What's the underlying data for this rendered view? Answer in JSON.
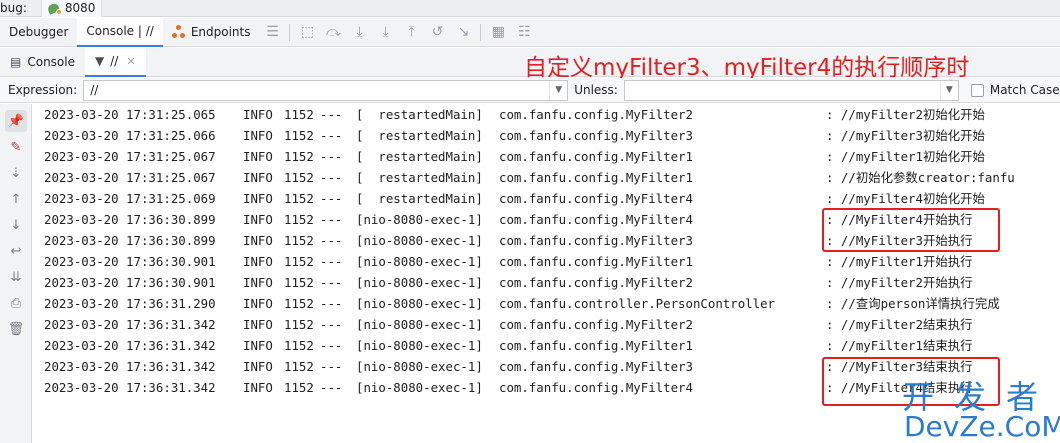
{
  "topbar": {
    "debug_label": "bug:",
    "run_tab_label": "8080"
  },
  "tabs": {
    "debugger": "Debugger",
    "console": "Console | //",
    "endpoints": "Endpoints"
  },
  "subtabs": {
    "console": "Console",
    "filter": "//"
  },
  "annotation": "自定义myFilter3、myFilter4的执行顺序时",
  "filter_bar": {
    "expression_label": "Expression:",
    "expression_value": "//",
    "unless_label": "Unless:",
    "unless_value": "",
    "match_case_label": "Match Case"
  },
  "log_lines": [
    {
      "ts": "2023-03-20 17:31:25.065",
      "level": "INFO",
      "pid": "1152",
      "sep": "---",
      "thread": "[  restartedMain]",
      "logger": "com.fanfu.config.MyFilter2",
      "msg": ": //myFilter2初始化开始"
    },
    {
      "ts": "2023-03-20 17:31:25.066",
      "level": "INFO",
      "pid": "1152",
      "sep": "---",
      "thread": "[  restartedMain]",
      "logger": "com.fanfu.config.MyFilter3",
      "msg": ": //myFilter3初始化开始"
    },
    {
      "ts": "2023-03-20 17:31:25.067",
      "level": "INFO",
      "pid": "1152",
      "sep": "---",
      "thread": "[  restartedMain]",
      "logger": "com.fanfu.config.MyFilter1",
      "msg": ": //myFilter1初始化开始"
    },
    {
      "ts": "2023-03-20 17:31:25.067",
      "level": "INFO",
      "pid": "1152",
      "sep": "---",
      "thread": "[  restartedMain]",
      "logger": "com.fanfu.config.MyFilter1",
      "msg": ": //初始化参数creator:fanfu"
    },
    {
      "ts": "2023-03-20 17:31:25.069",
      "level": "INFO",
      "pid": "1152",
      "sep": "---",
      "thread": "[  restartedMain]",
      "logger": "com.fanfu.config.MyFilter4",
      "msg": ": //myFilter4初始化开始"
    },
    {
      "ts": "2023-03-20 17:36:30.899",
      "level": "INFO",
      "pid": "1152",
      "sep": "---",
      "thread": "[nio-8080-exec-1]",
      "logger": "com.fanfu.config.MyFilter4",
      "msg": ": //MyFilter4开始执行"
    },
    {
      "ts": "2023-03-20 17:36:30.899",
      "level": "INFO",
      "pid": "1152",
      "sep": "---",
      "thread": "[nio-8080-exec-1]",
      "logger": "com.fanfu.config.MyFilter3",
      "msg": ": //MyFilter3开始执行"
    },
    {
      "ts": "2023-03-20 17:36:30.901",
      "level": "INFO",
      "pid": "1152",
      "sep": "---",
      "thread": "[nio-8080-exec-1]",
      "logger": "com.fanfu.config.MyFilter1",
      "msg": ": //myFilter1开始执行"
    },
    {
      "ts": "2023-03-20 17:36:30.901",
      "level": "INFO",
      "pid": "1152",
      "sep": "---",
      "thread": "[nio-8080-exec-1]",
      "logger": "com.fanfu.config.MyFilter2",
      "msg": ": //myFilter2开始执行"
    },
    {
      "ts": "2023-03-20 17:36:31.290",
      "level": "INFO",
      "pid": "1152",
      "sep": "---",
      "thread": "[nio-8080-exec-1]",
      "logger": "com.fanfu.controller.PersonController",
      "msg": ": //查询person详情执行完成"
    },
    {
      "ts": "2023-03-20 17:36:31.342",
      "level": "INFO",
      "pid": "1152",
      "sep": "---",
      "thread": "[nio-8080-exec-1]",
      "logger": "com.fanfu.config.MyFilter2",
      "msg": ": //myFilter2结束执行"
    },
    {
      "ts": "2023-03-20 17:36:31.342",
      "level": "INFO",
      "pid": "1152",
      "sep": "---",
      "thread": "[nio-8080-exec-1]",
      "logger": "com.fanfu.config.MyFilter1",
      "msg": ": //myFilter1结束执行"
    },
    {
      "ts": "2023-03-20 17:36:31.342",
      "level": "INFO",
      "pid": "1152",
      "sep": "---",
      "thread": "[nio-8080-exec-1]",
      "logger": "com.fanfu.config.MyFilter3",
      "msg": ": //MyFilter3结束执行"
    },
    {
      "ts": "2023-03-20 17:36:31.342",
      "level": "INFO",
      "pid": "1152",
      "sep": "---",
      "thread": "[nio-8080-exec-1]",
      "logger": "com.fanfu.config.MyFilter4",
      "msg": ": //MyFilter4结束执行"
    }
  ],
  "watermark": {
    "line1": "开发者",
    "line2": "DevZe.CoM"
  },
  "colors": {
    "accent": "#3d7ae6",
    "annotation_red": "#e51f1f",
    "watermark_blue": "#2b7bd0"
  },
  "icons": {
    "toolbar": [
      "menu-icon",
      "restore-layout-icon",
      "step-over-icon",
      "step-into-icon",
      "force-step-into-icon",
      "step-out-icon",
      "drop-frame-icon",
      "run-to-cursor-icon",
      "evaluate-icon",
      "trace-icon"
    ],
    "gutter": [
      "pin-icon",
      "clear-icon",
      "sort-icon",
      "up-icon",
      "down-icon",
      "soft-wrap-icon",
      "scroll-to-end-icon",
      "print-icon",
      "trash-icon"
    ]
  }
}
